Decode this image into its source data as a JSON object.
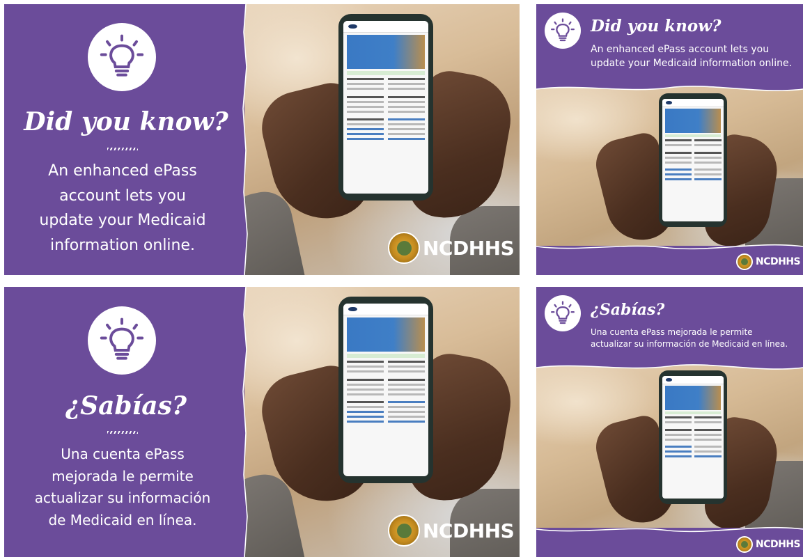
{
  "brand": {
    "logo_text": "NCDHHS",
    "primary_color": "#6b4c9a",
    "text_color": "#ffffff"
  },
  "icons": {
    "bulb": "lightbulb-icon",
    "seal": "nc-state-seal-icon"
  },
  "cards": {
    "en_wide": {
      "headline": "Did you know?",
      "body_lines": [
        "An enhanced ePass",
        "account lets you",
        "update your Medicaid",
        "information online."
      ]
    },
    "en_narrow": {
      "headline": "Did you know?",
      "body_lines": [
        "An enhanced ePass account lets you",
        "update your Medicaid information online."
      ]
    },
    "es_wide": {
      "headline": "¿Sabías?",
      "body_lines": [
        "Una cuenta ePass",
        "mejorada le permite",
        "actualizar su información",
        "de Medicaid en línea."
      ]
    },
    "es_narrow": {
      "headline": "¿Sabías?",
      "body_lines": [
        "Una cuenta ePass mejorada le permite",
        "actualizar su información de Medicaid en línea."
      ]
    }
  }
}
